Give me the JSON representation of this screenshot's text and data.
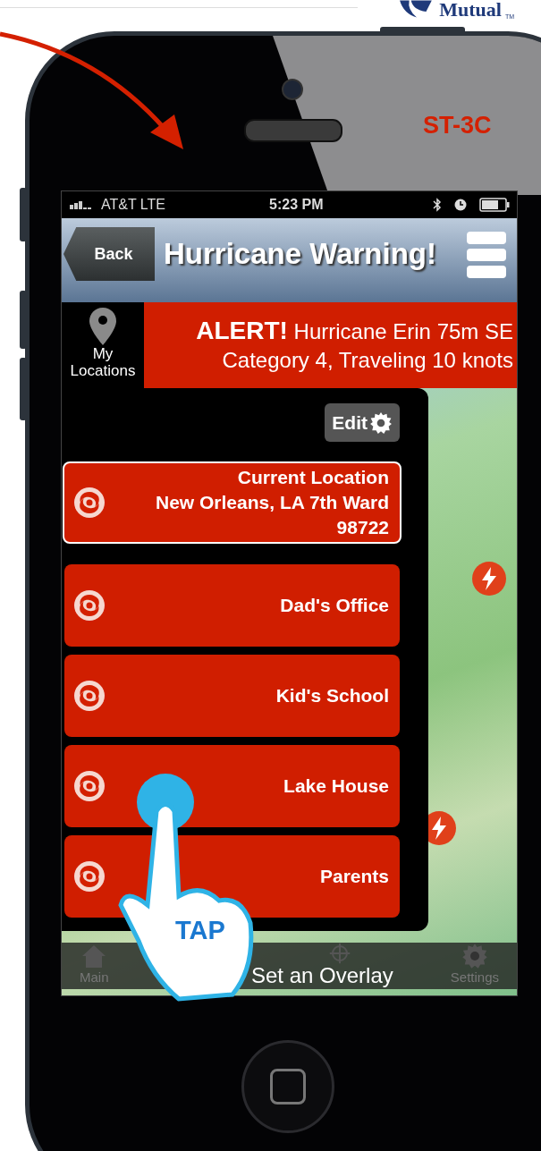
{
  "logo": {
    "text": "Mutual",
    "trademark": "TM"
  },
  "screen_label": "ST-3C",
  "status_bar": {
    "carrier": "AT&T LTE",
    "time": "5:23 PM"
  },
  "nav_bar": {
    "back": "Back",
    "title": "Hurricane Warning!"
  },
  "sidebar": {
    "label": "My Locations"
  },
  "alert": {
    "lines": [
      "**ALERT!** Hurricane Erin 75m SE",
      "Category 4, Traveling 10 knots"
    ]
  },
  "locations_panel": {
    "edit": "Edit",
    "items": [
      {
        "kind": "current",
        "lines": [
          "Current Location",
          "New Orleans, LA  7th Ward",
          "98722"
        ]
      },
      {
        "kind": "saved",
        "lines": [
          "Dad's Office"
        ]
      },
      {
        "kind": "saved",
        "lines": [
          "Kid's School"
        ]
      },
      {
        "kind": "saved",
        "lines": [
          "Lake House"
        ]
      },
      {
        "kind": "saved",
        "lines": [
          "Parents"
        ]
      }
    ]
  },
  "tab_bar": {
    "hint": "Set an Overlay",
    "tabs": [
      {
        "label": "Main"
      },
      {
        "label": "Settings"
      }
    ]
  },
  "gesture": {
    "label": "TAP"
  }
}
